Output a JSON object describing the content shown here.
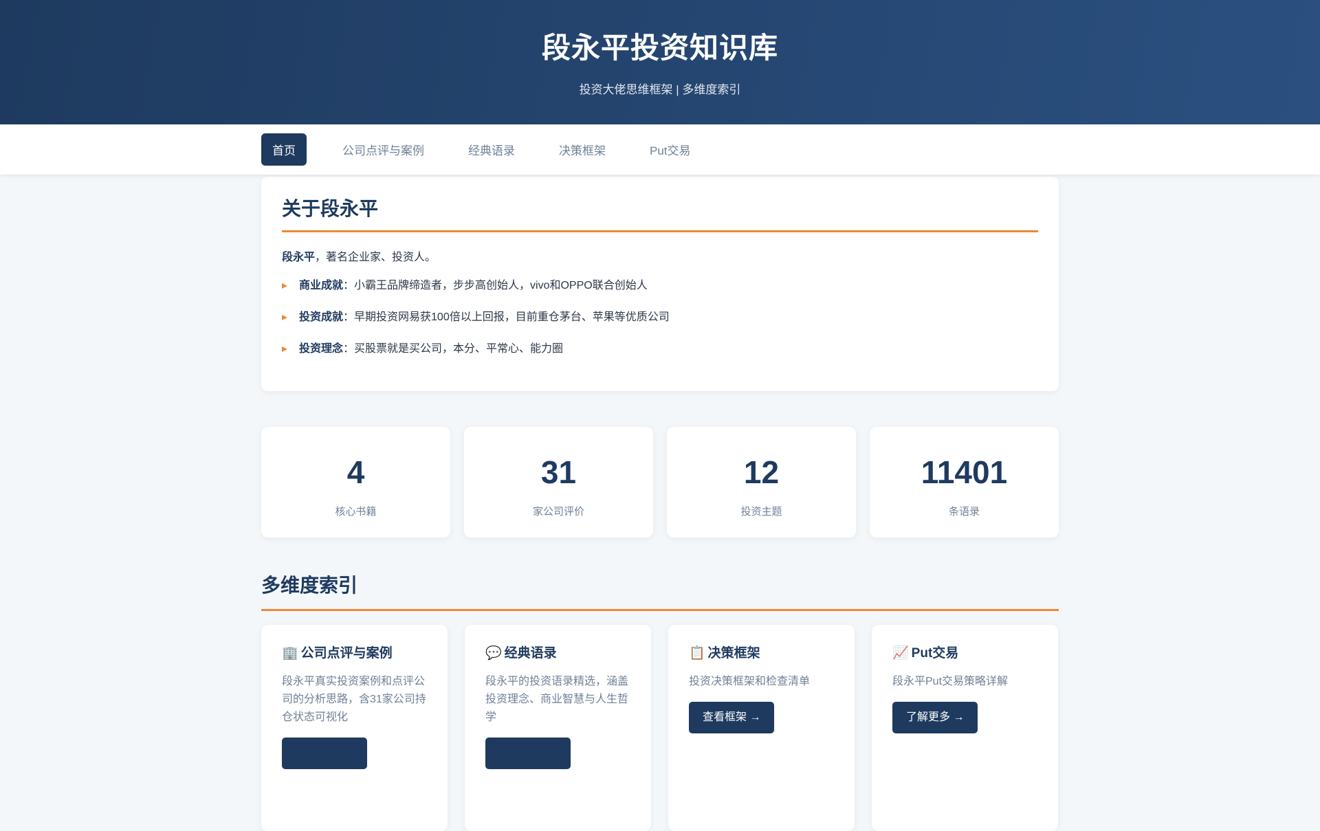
{
  "header": {
    "title": "段永平投资知识库",
    "subtitle": "投资大佬思维框架 | 多维度索引"
  },
  "nav": {
    "items": [
      "首页",
      "公司点评与案例",
      "经典语录",
      "决策框架",
      "Put交易"
    ]
  },
  "about": {
    "title": "关于段永平",
    "intro_name": "段永平",
    "intro_rest": "，著名企业家、投资人。",
    "bullets": [
      {
        "label": "商业成就",
        "text": "：小霸王品牌缔造者，步步高创始人，vivo和OPPO联合创始人"
      },
      {
        "label": "投资成就",
        "text": "：早期投资网易获100倍以上回报，目前重仓茅台、苹果等优质公司"
      },
      {
        "label": "投资理念",
        "text": "：买股票就是买公司，本分、平常心、能力圈"
      }
    ]
  },
  "stats": [
    {
      "value": "4",
      "label": "核心书籍"
    },
    {
      "value": "31",
      "label": "家公司评价"
    },
    {
      "value": "12",
      "label": "投资主题"
    },
    {
      "value": "11401",
      "label": "条语录"
    }
  ],
  "index": {
    "title": "多维度索引",
    "cards": [
      {
        "icon": "🏢",
        "title": "公司点评与案例",
        "desc": "段永平真实投资案例和点评公司的分析思路，含31家公司持仓状态可视化",
        "button": ""
      },
      {
        "icon": "💬",
        "title": "经典语录",
        "desc": "段永平的投资语录精选，涵盖投资理念、商业智慧与人生哲学",
        "button": ""
      },
      {
        "icon": "📋",
        "title": "决策框架",
        "desc": "投资决策框架和检查清单",
        "button": "查看框架 →"
      },
      {
        "icon": "📈",
        "title": "Put交易",
        "desc": "段永平Put交易策略详解",
        "button": "了解更多 →"
      }
    ]
  }
}
